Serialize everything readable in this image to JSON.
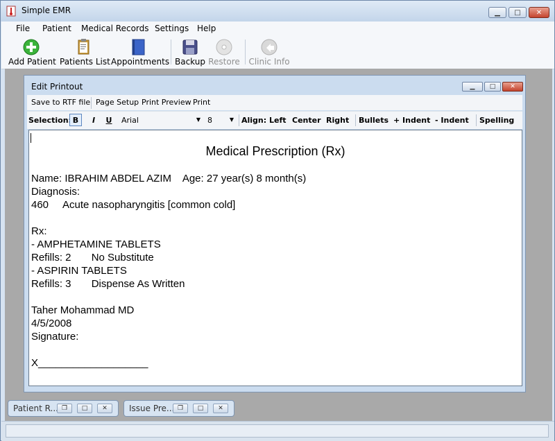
{
  "app": {
    "title": "Simple EMR"
  },
  "menu": [
    "File",
    "Patient",
    "Medical Records",
    "Settings",
    "Help"
  ],
  "toolbar": {
    "add_patient": "Add Patient",
    "patients_list": "Patients List",
    "appointments": "Appointments",
    "backup": "Backup",
    "restore": "Restore",
    "clinic_info": "Clinic Info"
  },
  "colors": {
    "add_green": "#3bb33b",
    "accent_blue": "#3b64c8",
    "close_red": "#c4442e"
  },
  "child": {
    "title": "Edit Printout",
    "menu": {
      "save_rtf": "Save to RTF file",
      "page_setup": "Page Setup",
      "print_preview": "Print Preview",
      "print": "Print"
    },
    "format": {
      "selection_label": "Selection:",
      "bold": "B",
      "italic": "I",
      "underline": "U",
      "font": "Arial",
      "size": "8",
      "align_label": "Align:",
      "left": "Left",
      "center": "Center",
      "right": "Right",
      "bullets": "Bullets",
      "indent": "+ Indent",
      "outdent": "- Indent",
      "spelling": "Spelling"
    }
  },
  "document": {
    "title": "Medical Prescription (Rx)",
    "name_line": "Name: IBRAHIM ABDEL AZIM    Age: 27 year(s) 8 month(s)",
    "diagnosis_label": "Diagnosis:",
    "diagnosis_line": "460     Acute nasopharyngitis [common cold]",
    "rx_label": "Rx:",
    "med1": "- AMPHETAMINE TABLETS",
    "refills1": "Refills: 2       No Substitute",
    "med2": "- ASPIRIN TABLETS",
    "refills2": "Refills: 3       Dispense As Written",
    "doctor": "Taher Mohammad MD",
    "date": "4/5/2008",
    "signature_label": "Signature:",
    "signature_line": "X___________________"
  },
  "minimized": [
    {
      "title": "Patient R..."
    },
    {
      "title": "Issue Pre..."
    }
  ]
}
